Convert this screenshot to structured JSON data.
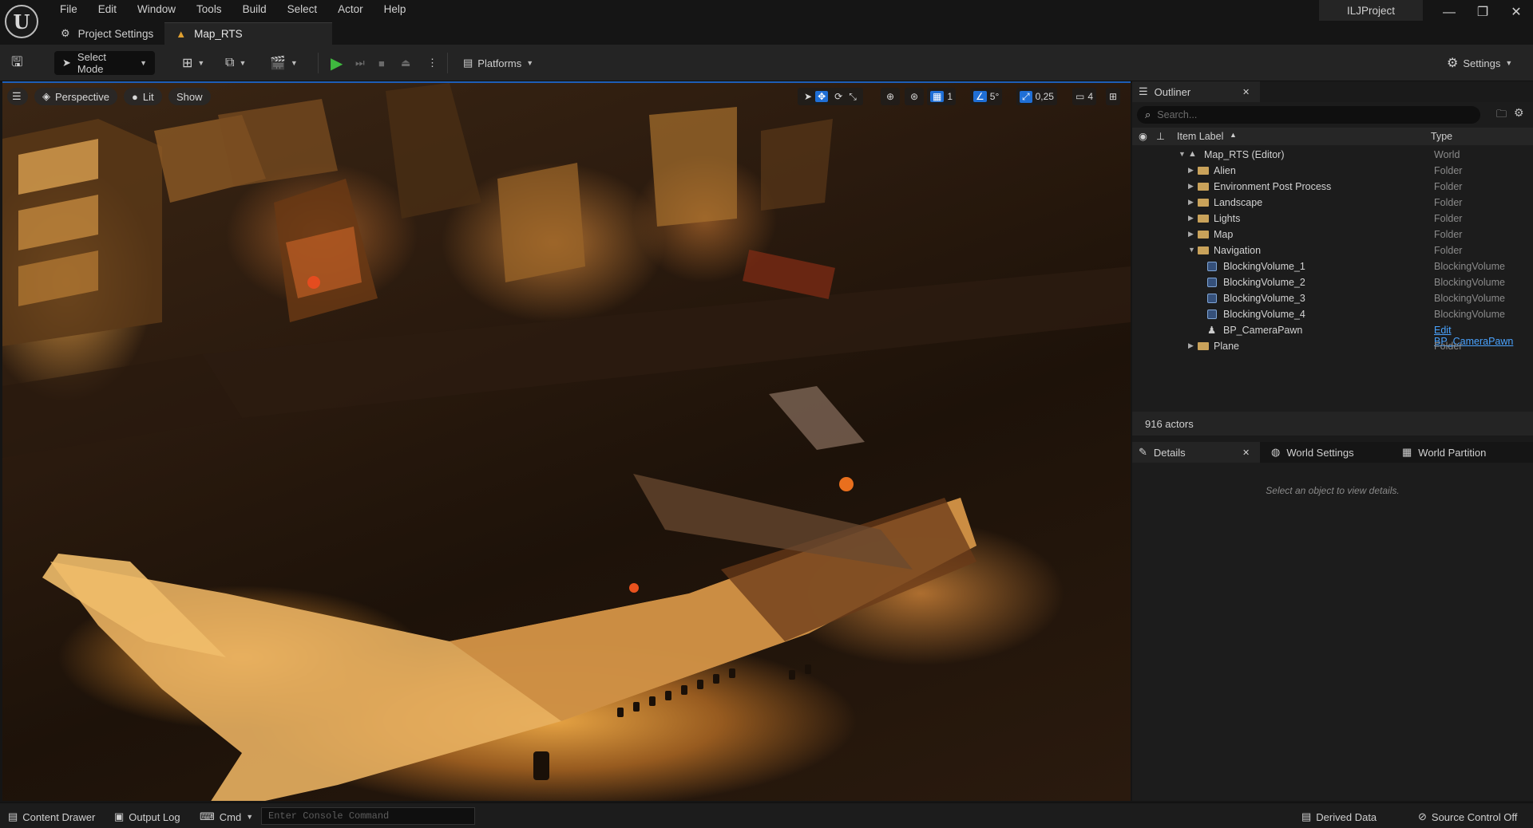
{
  "app": {
    "project_name": "ILJProject",
    "logo_text": "U"
  },
  "menu": [
    "File",
    "Edit",
    "Window",
    "Tools",
    "Build",
    "Select",
    "Actor",
    "Help"
  ],
  "tabs": [
    {
      "label": "Project Settings",
      "icon": "gear-icon"
    },
    {
      "label": "Map_RTS",
      "icon": "level-icon"
    }
  ],
  "toolbar": {
    "select_mode": "Select Mode",
    "platforms": "Platforms",
    "settings": "Settings"
  },
  "viewport": {
    "perspective": "Perspective",
    "lit": "Lit",
    "show": "Show",
    "grid_snap": "1",
    "rotation_snap": "5°",
    "scale_snap": "0,25",
    "camera_speed": "4"
  },
  "outliner": {
    "tab_label": "Outliner",
    "search_placeholder": "Search...",
    "col_label": "Item Label",
    "col_type": "Type",
    "items": [
      {
        "label": "Map_RTS (Editor)",
        "type": "World",
        "level": 0,
        "kind": "world",
        "expanded": true
      },
      {
        "label": "Alien",
        "type": "Folder",
        "level": 1,
        "kind": "folder",
        "expanded": false
      },
      {
        "label": "Environment Post Process",
        "type": "Folder",
        "level": 1,
        "kind": "folder",
        "expanded": false
      },
      {
        "label": "Landscape",
        "type": "Folder",
        "level": 1,
        "kind": "folder",
        "expanded": false
      },
      {
        "label": "Lights",
        "type": "Folder",
        "level": 1,
        "kind": "folder",
        "expanded": false
      },
      {
        "label": "Map",
        "type": "Folder",
        "level": 1,
        "kind": "folder",
        "expanded": false
      },
      {
        "label": "Navigation",
        "type": "Folder",
        "level": 1,
        "kind": "folder",
        "expanded": true
      },
      {
        "label": "BlockingVolume_1",
        "type": "BlockingVolume",
        "level": 2,
        "kind": "volume"
      },
      {
        "label": "BlockingVolume_2",
        "type": "BlockingVolume",
        "level": 2,
        "kind": "volume"
      },
      {
        "label": "BlockingVolume_3",
        "type": "BlockingVolume",
        "level": 2,
        "kind": "volume"
      },
      {
        "label": "BlockingVolume_4",
        "type": "BlockingVolume",
        "level": 2,
        "kind": "volume"
      },
      {
        "label": "BP_CameraPawn",
        "type": "Edit BP_CameraPawn",
        "level": 2,
        "kind": "pawn",
        "type_link": true
      },
      {
        "label": "Plane",
        "type": "Folder",
        "level": 1,
        "kind": "folder",
        "expanded": false
      }
    ],
    "actor_count": "916 actors"
  },
  "details": {
    "tabs": [
      "Details",
      "World Settings",
      "World Partition"
    ],
    "empty_message": "Select an object to view details."
  },
  "statusbar": {
    "content_drawer": "Content Drawer",
    "output_log": "Output Log",
    "cmd": "Cmd",
    "console_placeholder": "Enter Console Command",
    "derived_data": "Derived Data",
    "source_control": "Source Control Off"
  },
  "colors": {
    "accent": "#1f6fd6",
    "play_green": "#3fb83f",
    "link": "#4aa3ff",
    "folder": "#c9a25a"
  }
}
